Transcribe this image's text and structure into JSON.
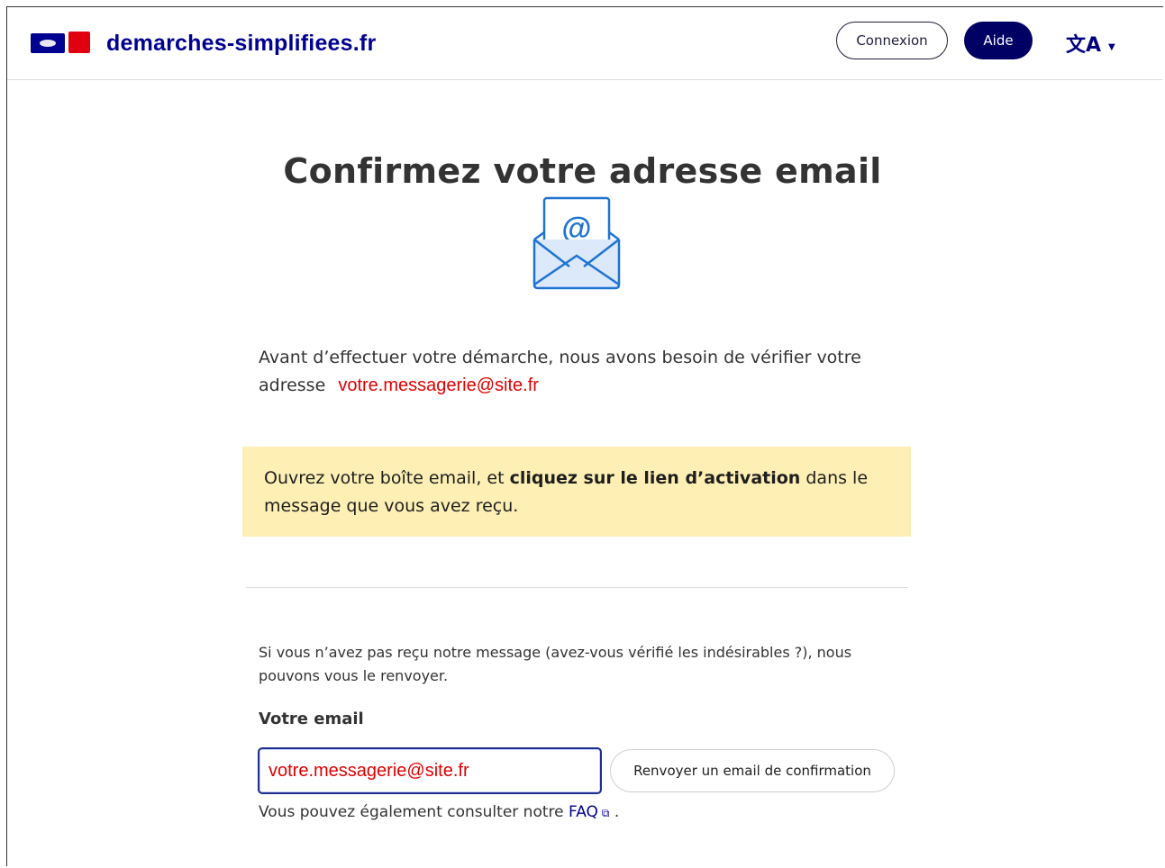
{
  "header": {
    "brand": "demarches-simplifiees.fr",
    "connexion_label": "Connexion",
    "aide_label": "Aide",
    "lang_glyph": "文A",
    "lang_caret": "▼"
  },
  "main": {
    "title": "Confirmez votre adresse email",
    "intro_before": "Avant d’effectuer votre démarche, nous avons besoin de vérifier votre adresse",
    "intro_email": "votre.messagerie@site.fr",
    "notice_before": "Ouvrez votre boîte email, et ",
    "notice_bold": "cliquez sur le lien d’activation",
    "notice_after": " dans le message que vous avez reçu.",
    "resend_text": "Si vous n’avez pas reçu notre message (avez-vous vérifié les indésirables ?), nous pouvons vous le renvoyer.",
    "email_label": "Votre email",
    "email_value": "votre.messagerie@site.fr",
    "resend_button": "Renvoyer un email de confirmation",
    "faq_before": "Vous pouvez également consulter notre ",
    "faq_link": "FAQ",
    "faq_after": " ."
  },
  "icons": {
    "logo": "marianne-logo-icon",
    "translate": "translate-icon",
    "mail": "envelope-at-icon",
    "external": "external-link-icon"
  },
  "colors": {
    "brand_blue": "#000091",
    "aide_bg": "#000064",
    "notice_bg": "#fef0b5",
    "email_red": "#e00000",
    "icon_blue": "#1f73d2"
  }
}
